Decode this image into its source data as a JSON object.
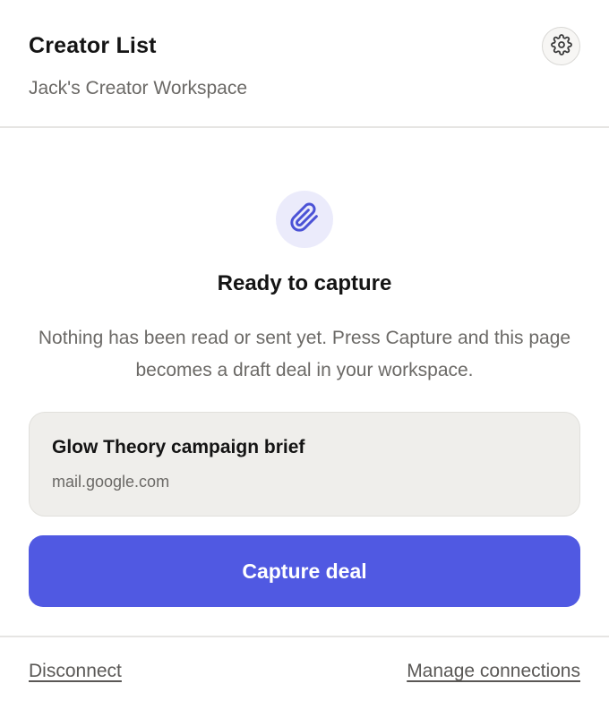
{
  "header": {
    "title": "Creator List",
    "subtitle": "Jack's Creator Workspace",
    "settings_icon": "gear-icon"
  },
  "main": {
    "badge_icon": "paperclip-icon",
    "heading": "Ready to capture",
    "description": "Nothing has been read or sent yet. Press Capture and this page becomes a draft deal in your workspace.",
    "source": {
      "title": "Glow Theory campaign brief",
      "host": "mail.google.com"
    },
    "capture_label": "Capture deal"
  },
  "footer": {
    "disconnect_label": "Disconnect",
    "manage_label": "Manage connections"
  },
  "colors": {
    "accent": "#5059e2",
    "badge_bg": "#ebebfb",
    "card_bg": "#efeeeb",
    "muted_text": "#6b6966"
  }
}
